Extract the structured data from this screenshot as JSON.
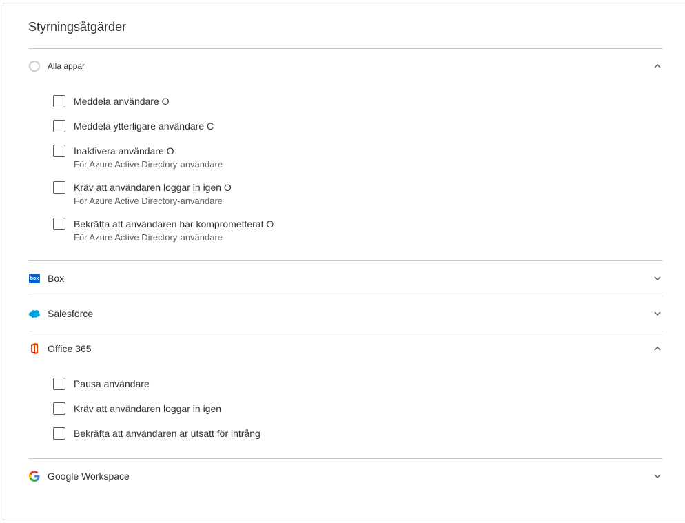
{
  "title": "Styrningsåtgärder",
  "sections": {
    "all_apps": {
      "label": "Alla appar",
      "expanded": true,
      "options": [
        {
          "label": "Meddela användare O",
          "sub": ""
        },
        {
          "label": "Meddela ytterligare användare C",
          "sub": ""
        },
        {
          "label": "Inaktivera användare O",
          "sub": "För Azure Active Directory-användare"
        },
        {
          "label": "Kräv att användaren loggar in igen O",
          "sub": "För Azure Active Directory-användare"
        },
        {
          "label": "Bekräfta att användaren har komprometterat O",
          "sub": "För Azure Active Directory-användare"
        }
      ]
    },
    "box": {
      "label": "Box",
      "expanded": false
    },
    "salesforce": {
      "label": "Salesforce",
      "expanded": false
    },
    "office365": {
      "label": "Office 365",
      "expanded": true,
      "options": [
        {
          "label": "Pausa användare",
          "sub": ""
        },
        {
          "label": "Kräv att användaren loggar in igen",
          "sub": ""
        },
        {
          "label": "Bekräfta att användaren är utsatt för intrång",
          "sub": ""
        }
      ]
    },
    "google": {
      "label": "Google Workspace",
      "expanded": false
    }
  },
  "icon_text": {
    "box": "box"
  }
}
